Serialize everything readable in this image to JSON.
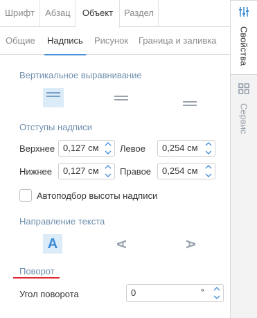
{
  "tabs": [
    "Шрифт",
    "Абзац",
    "Объект",
    "Раздел"
  ],
  "subtabs": [
    "Общие",
    "Надпись",
    "Рисунок",
    "Граница и заливка"
  ],
  "vertical_alignment": {
    "title": "Вертикальное выравнивание",
    "selected": "top"
  },
  "margins": {
    "title": "Отступы надписи",
    "top_label": "Верхнее",
    "top_value": "0,127 см",
    "left_label": "Левое",
    "left_value": "0,254 см",
    "bottom_label": "Нижнее",
    "bottom_value": "0,127 см",
    "right_label": "Правое",
    "right_value": "0,254 см"
  },
  "autofit": {
    "label": "Автоподбор высоты надписи",
    "checked": false
  },
  "text_direction": {
    "title": "Направление текста",
    "glyph": "A",
    "selected": "horizontal"
  },
  "rotation": {
    "title": "Поворот",
    "angle_label": "Угол поворота",
    "angle_value": "0",
    "unit": "°"
  },
  "sidebar": [
    {
      "label": "Свойства",
      "icon": "sliders-icon",
      "active": true
    },
    {
      "label": "Сервис",
      "icon": "grid-icon",
      "active": false
    }
  ],
  "colors": {
    "accent": "#4a90d9",
    "selected_bg": "#dcebf8",
    "section_label": "#6f8fae",
    "underline_red": "#e0242f"
  }
}
